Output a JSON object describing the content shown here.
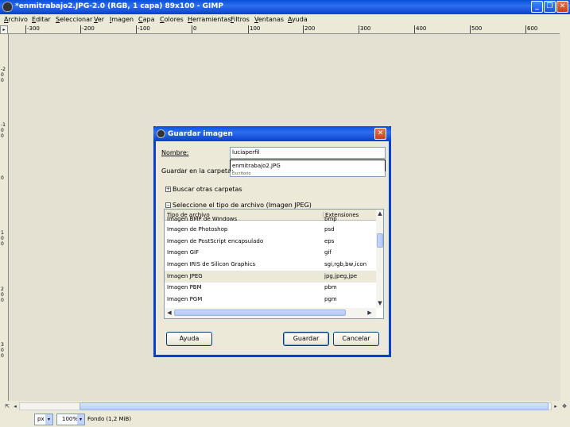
{
  "window": {
    "title": "*enmitrabajo2.JPG-2.0 (RGB, 1 capa) 89x100 - GIMP",
    "minimize": "_",
    "restore": "❐",
    "close": "✕"
  },
  "menubar": {
    "items": [
      "Archivo",
      "Editar",
      "Seleccionar",
      "Ver",
      "Imagen",
      "Capa",
      "Colores",
      "Herramientas",
      "Filtros",
      "Ventanas",
      "Ayuda"
    ]
  },
  "rulers": {
    "horizontal_labels": [
      "-300",
      "-200",
      "-100",
      "0",
      "100",
      "200",
      "300",
      "400",
      "500",
      "600"
    ],
    "vertical_labels": [
      "-200",
      "-100",
      "0",
      "100",
      "200",
      "300"
    ]
  },
  "statusbar": {
    "unit": "px",
    "zoom": "100%",
    "info": "Fondo (1,2 MiB)"
  },
  "dialog": {
    "title": "Guardar imagen",
    "name_label": "Nombre:",
    "name_value": "luciaperfil",
    "autocomplete_suggestion": "enmitrabajo2.JPG",
    "folder_label": "Guardar en la carpeta:",
    "folder_value": "Escritorio",
    "browse_expander": "Buscar otras carpetas",
    "filetype_expander": "Seleccione el tipo de archivo (Imagen JPEG)",
    "filetype_table": {
      "columns": [
        "Tipo de archivo",
        "Extensiones"
      ],
      "rows": [
        {
          "type": "Imagen BMP de Windows",
          "ext": "bmp"
        },
        {
          "type": "Imagen de Photoshop",
          "ext": "psd"
        },
        {
          "type": "Imagen de PostScript encapsulado",
          "ext": "eps"
        },
        {
          "type": "Imagen GIF",
          "ext": "gif"
        },
        {
          "type": "Imagen IRIS de Silicon Graphics",
          "ext": "sgi,rgb,bw,icon"
        },
        {
          "type": "Imagen JPEG",
          "ext": "jpg,jpeg,jpe"
        },
        {
          "type": "Imagen PBM",
          "ext": "pbm"
        },
        {
          "type": "Imagen PGM",
          "ext": "pgm"
        }
      ],
      "selected_row": "Imagen JPEG"
    },
    "buttons": {
      "help": "Ayuda",
      "save": "Guardar",
      "cancel": "Cancelar"
    }
  }
}
